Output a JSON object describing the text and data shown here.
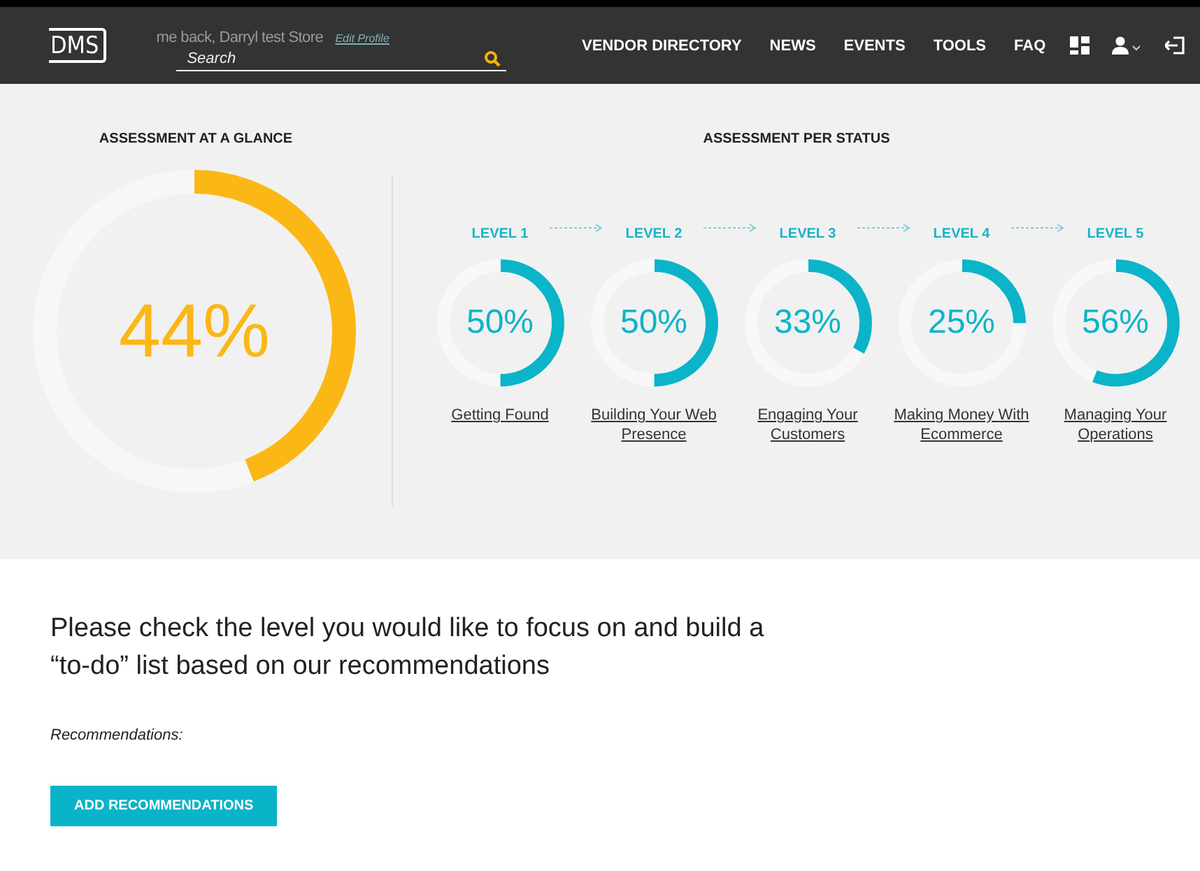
{
  "header": {
    "logo": "DMS",
    "greeting": "me back, Darryl test Store",
    "edit_profile": "Edit Profile",
    "search": {
      "placeholder": "Search"
    },
    "nav": [
      "VENDOR DIRECTORY",
      "NEWS",
      "EVENTS",
      "TOOLS",
      "FAQ"
    ]
  },
  "glance": {
    "title": "ASSESSMENT AT A GLANCE",
    "reading": "44%"
  },
  "status": {
    "title": "ASSESSMENT PER STATUS",
    "levels": [
      {
        "label": "LEVEL 1",
        "reading": "50%",
        "name": "Getting Found"
      },
      {
        "label": "LEVEL 2",
        "reading": "50%",
        "name": "Building Your Web Presence"
      },
      {
        "label": "LEVEL 3",
        "reading": "33%",
        "name": "Engaging Your Customers"
      },
      {
        "label": "LEVEL 4",
        "reading": "25%",
        "name": "Making Money With Ecommerce"
      },
      {
        "label": "LEVEL 5",
        "reading": "56%",
        "name": "Managing Your Operations"
      }
    ]
  },
  "intro": "Please check the level you would like to focus on and build a “to-do” list based on our recommendations",
  "recommendations_label": "Recommendations:",
  "button": "ADD RECOMMENDATIONS"
}
